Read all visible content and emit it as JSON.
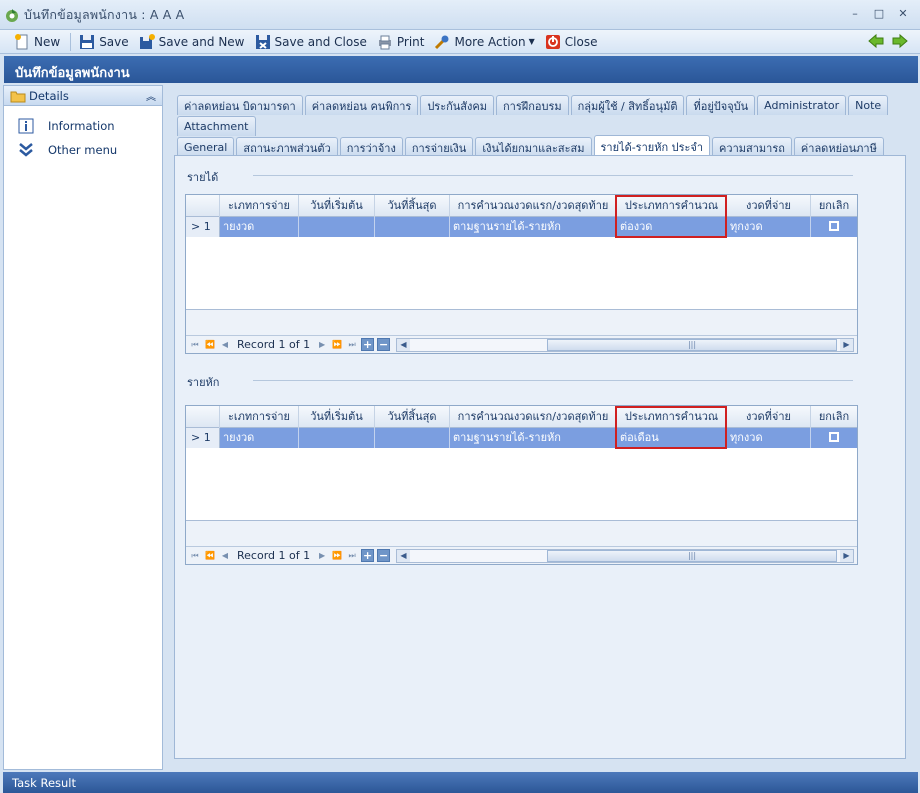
{
  "window": {
    "title": "บันทึกข้อมูลพนักงาน : A  A A",
    "controls": [
      "–",
      "□",
      "✕"
    ]
  },
  "toolbar": {
    "new": "New",
    "save": "Save",
    "save_and_new": "Save and New",
    "save_and_close": "Save and Close",
    "print": "Print",
    "more_action": "More Action",
    "close": "Close"
  },
  "banner": {
    "title": "บันทึกข้อมูลพนักงาน"
  },
  "left_panel": {
    "header": "Details",
    "items": [
      {
        "label": "Information",
        "icon": "info-icon"
      },
      {
        "label": "Other menu",
        "icon": "chevrons-down-icon"
      }
    ]
  },
  "tabs": {
    "row1": [
      "ค่าลดหย่อน บิดามารดา",
      "ค่าลดหย่อน คนพิการ",
      "ประกันสังคม",
      "การฝึกอบรม",
      "กลุ่มผู้ใช้ / สิทธิ์อนุมัติ",
      "ที่อยู่ปัจจุบัน",
      "Administrator",
      "Note"
    ],
    "row2": [
      "Attachment"
    ],
    "row3": [
      "General",
      "สถานะภาพส่วนตัว",
      "การว่าจ้าง",
      "การจ่ายเงิน",
      "เงินได้ยกมาและสะสม",
      "รายได้-รายหัก ประจำ",
      "ความสามารถ",
      "ค่าลดหย่อนภาษี"
    ],
    "active": "รายได้-รายหัก ประจำ"
  },
  "income_grid": {
    "group_label": "รายได้",
    "columns": [
      "ะเภทการจ่าย",
      "วันที่เริ่มต้น",
      "วันที่สิ้นสุด",
      "การคำนวณงวดแรก/งวดสุดท้าย",
      "ประเภทการคำนวณ",
      "งวดที่จ่าย",
      "ยกเลิก"
    ],
    "rows": [
      {
        "indicator": "1",
        "cells": [
          "ายงวด",
          "",
          "",
          "ตามฐานรายได้-รายหัก",
          "ต่องวด",
          "ทุกงวด",
          ""
        ]
      }
    ],
    "record_text": "Record 1 of 1"
  },
  "deduction_grid": {
    "group_label": "รายหัก",
    "columns": [
      "ะเภทการจ่าย",
      "วันที่เริ่มต้น",
      "วันที่สิ้นสุด",
      "การคำนวณงวดแรก/งวดสุดท้าย",
      "ประเภทการคำนวณ",
      "งวดที่จ่าย",
      "ยกเลิก"
    ],
    "rows": [
      {
        "indicator": "1",
        "cells": [
          "ายงวด",
          "",
          "",
          "ตามฐานรายได้-รายหัก",
          "ต่อเดือน",
          "ทุกงวด",
          ""
        ]
      }
    ],
    "record_text": "Record 1 of 1"
  },
  "status_bar": {
    "text": "Task Result"
  },
  "colors": {
    "banner": "#2f5d9f",
    "selected_row": "#7b9ee0",
    "highlight_box": "#d02020"
  }
}
